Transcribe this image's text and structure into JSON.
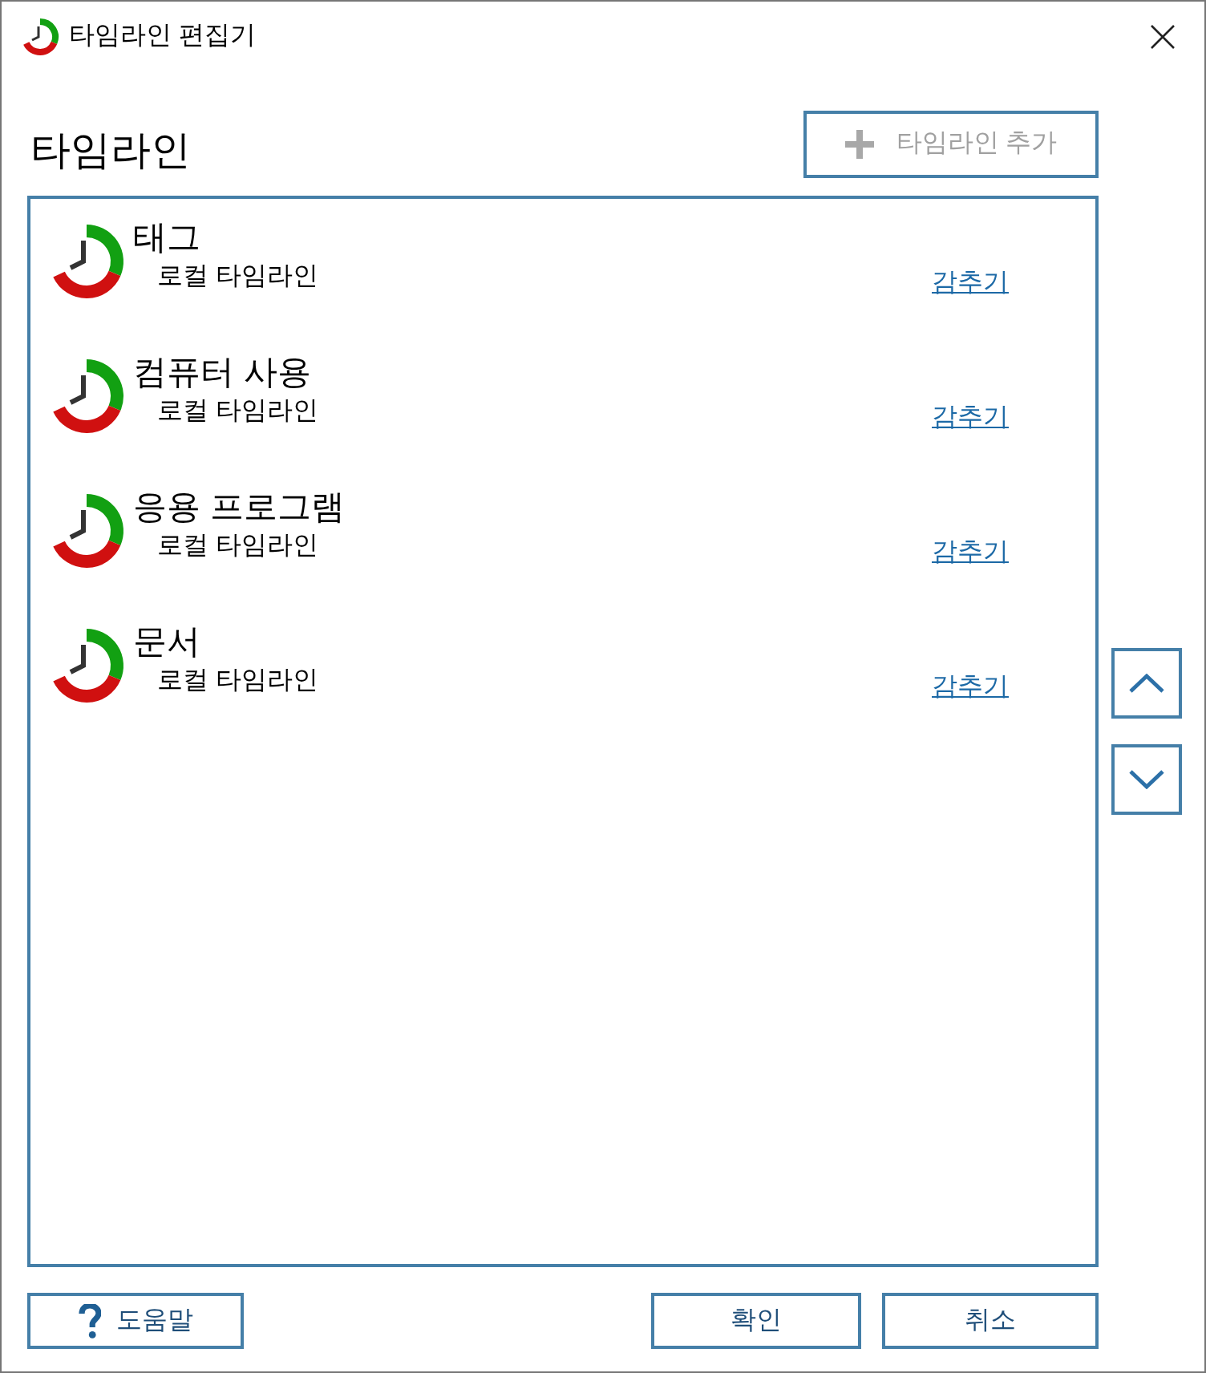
{
  "window": {
    "title": "타임라인 편집기"
  },
  "heading": "타임라인",
  "add_button": {
    "label": "타임라인 추가",
    "disabled": true
  },
  "timelines": [
    {
      "name": "태그",
      "source": "로컬 타임라인",
      "action": "감추기"
    },
    {
      "name": "컴퓨터 사용",
      "source": "로컬 타임라인",
      "action": "감추기"
    },
    {
      "name": "응용 프로그램",
      "source": "로컬 타임라인",
      "action": "감추기"
    },
    {
      "name": "문서",
      "source": "로컬 타임라인",
      "action": "감추기"
    }
  ],
  "footer": {
    "help_button": "도움말",
    "ok_button": "확인",
    "cancel_button": "취소"
  }
}
